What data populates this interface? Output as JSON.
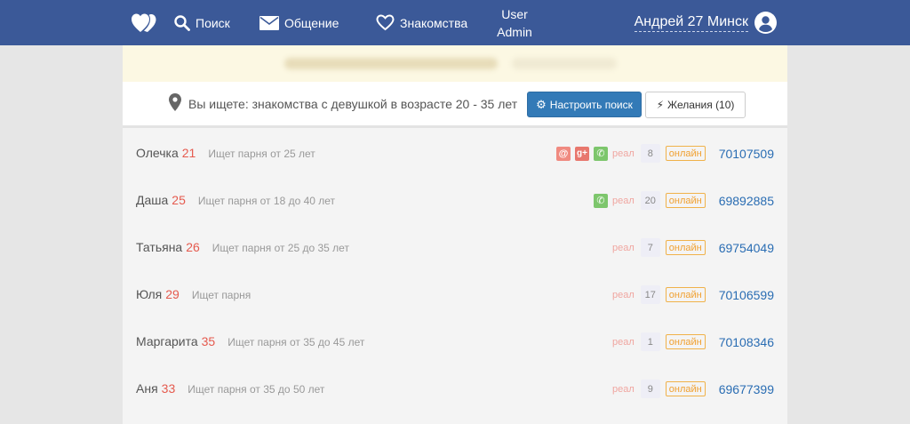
{
  "nav": {
    "search_label": "Поиск",
    "messages_label": "Общение",
    "dating_label": "Знакомства",
    "user_line1": "User",
    "user_line2": "Admin",
    "profile_name": "Андрей 27 Минск"
  },
  "search": {
    "text": "Вы ищете: знакомства с девушкой в возрасте 20 - 35 лет",
    "settings_label": "Настроить поиск",
    "wishes_label": "Желания (10)"
  },
  "profiles": [
    {
      "name": "Олечка",
      "age": "21",
      "seeks": "Ищет парня от 25 лет",
      "real": "реал",
      "count": "8",
      "status": "онлайн",
      "id": "70107509",
      "icons": [
        "mail",
        "gplus",
        "phone"
      ]
    },
    {
      "name": "Даша",
      "age": "25",
      "seeks": "Ищет парня от 18 до 40 лет",
      "real": "реал",
      "count": "20",
      "status": "онлайн",
      "id": "69892885",
      "icons": [
        "phone"
      ]
    },
    {
      "name": "Татьяна",
      "age": "26",
      "seeks": "Ищет парня от 25 до 35 лет",
      "real": "реал",
      "count": "7",
      "status": "онлайн",
      "id": "69754049",
      "icons": []
    },
    {
      "name": "Юля",
      "age": "29",
      "seeks": "Ищет парня",
      "real": "реал",
      "count": "17",
      "status": "онлайн",
      "id": "70106599",
      "icons": []
    },
    {
      "name": "Маргарита",
      "age": "35",
      "seeks": "Ищет парня от 35 до 45 лет",
      "real": "реал",
      "count": "1",
      "status": "онлайн",
      "id": "70108346",
      "icons": []
    },
    {
      "name": "Аня",
      "age": "33",
      "seeks": "Ищет парня от 35 до 50 лет",
      "real": "реал",
      "count": "9",
      "status": "онлайн",
      "id": "69677399",
      "icons": []
    }
  ],
  "colors": {
    "navbar": "#3b5998",
    "accent_button": "#337ab7",
    "age": "#e55a4e",
    "online_badge": "#f0b24a",
    "id_link": "#2a6db3"
  }
}
